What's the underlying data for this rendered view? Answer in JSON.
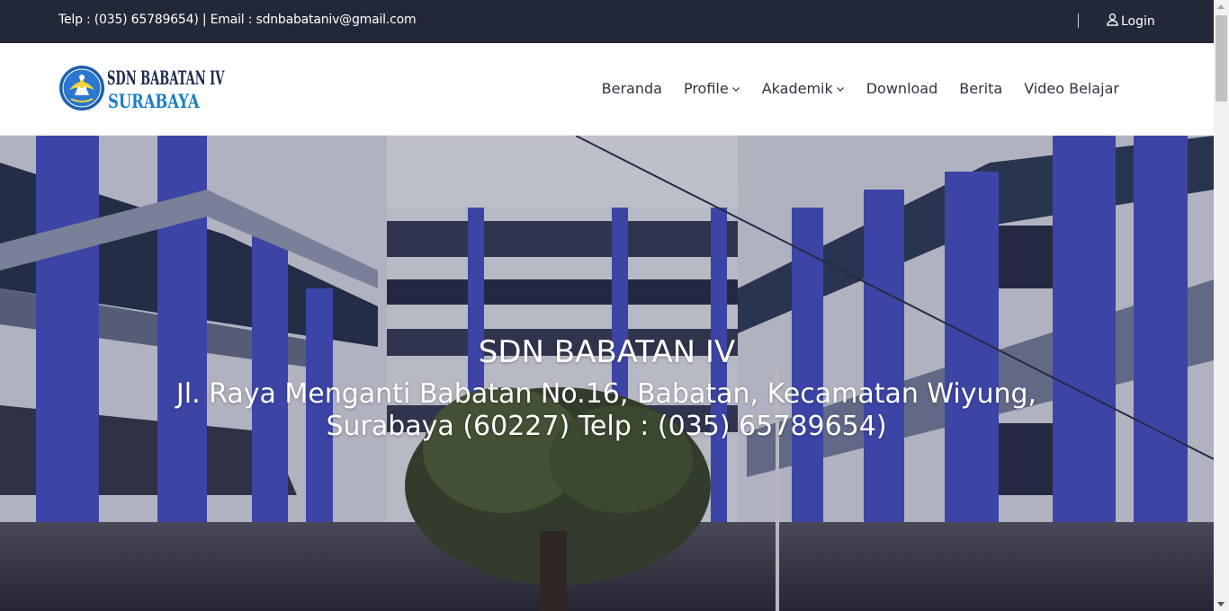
{
  "topbar": {
    "contact": "Telp : (035) 65789654) | Email : sdnbabataniv@gmail.com",
    "login_label": "Login"
  },
  "brand": {
    "line1": "SDN BABATAN IV",
    "line2": "SURABAYA"
  },
  "nav": {
    "items": [
      {
        "label": "Beranda",
        "dropdown": false
      },
      {
        "label": "Profile",
        "dropdown": true
      },
      {
        "label": "Akademik",
        "dropdown": true
      },
      {
        "label": "Download",
        "dropdown": false
      },
      {
        "label": "Berita",
        "dropdown": false
      },
      {
        "label": "Video Belajar",
        "dropdown": false
      }
    ]
  },
  "hero": {
    "title": "SDN BABATAN IV",
    "address": "Jl. Raya Menganti Babatan No.16, Babatan, Kecamatan Wiyung, Surabaya (60227) Telp : (035) 65789654)"
  },
  "colors": {
    "topbar_bg": "#232838",
    "nav_text": "#2f3442",
    "brand_blue": "#1a7fc4",
    "building_blue": "#4b55c8"
  },
  "icons": {
    "login": "user-icon",
    "dropdown": "chevron-down-icon",
    "emblem": "tut-wuri-handayani-logo"
  }
}
